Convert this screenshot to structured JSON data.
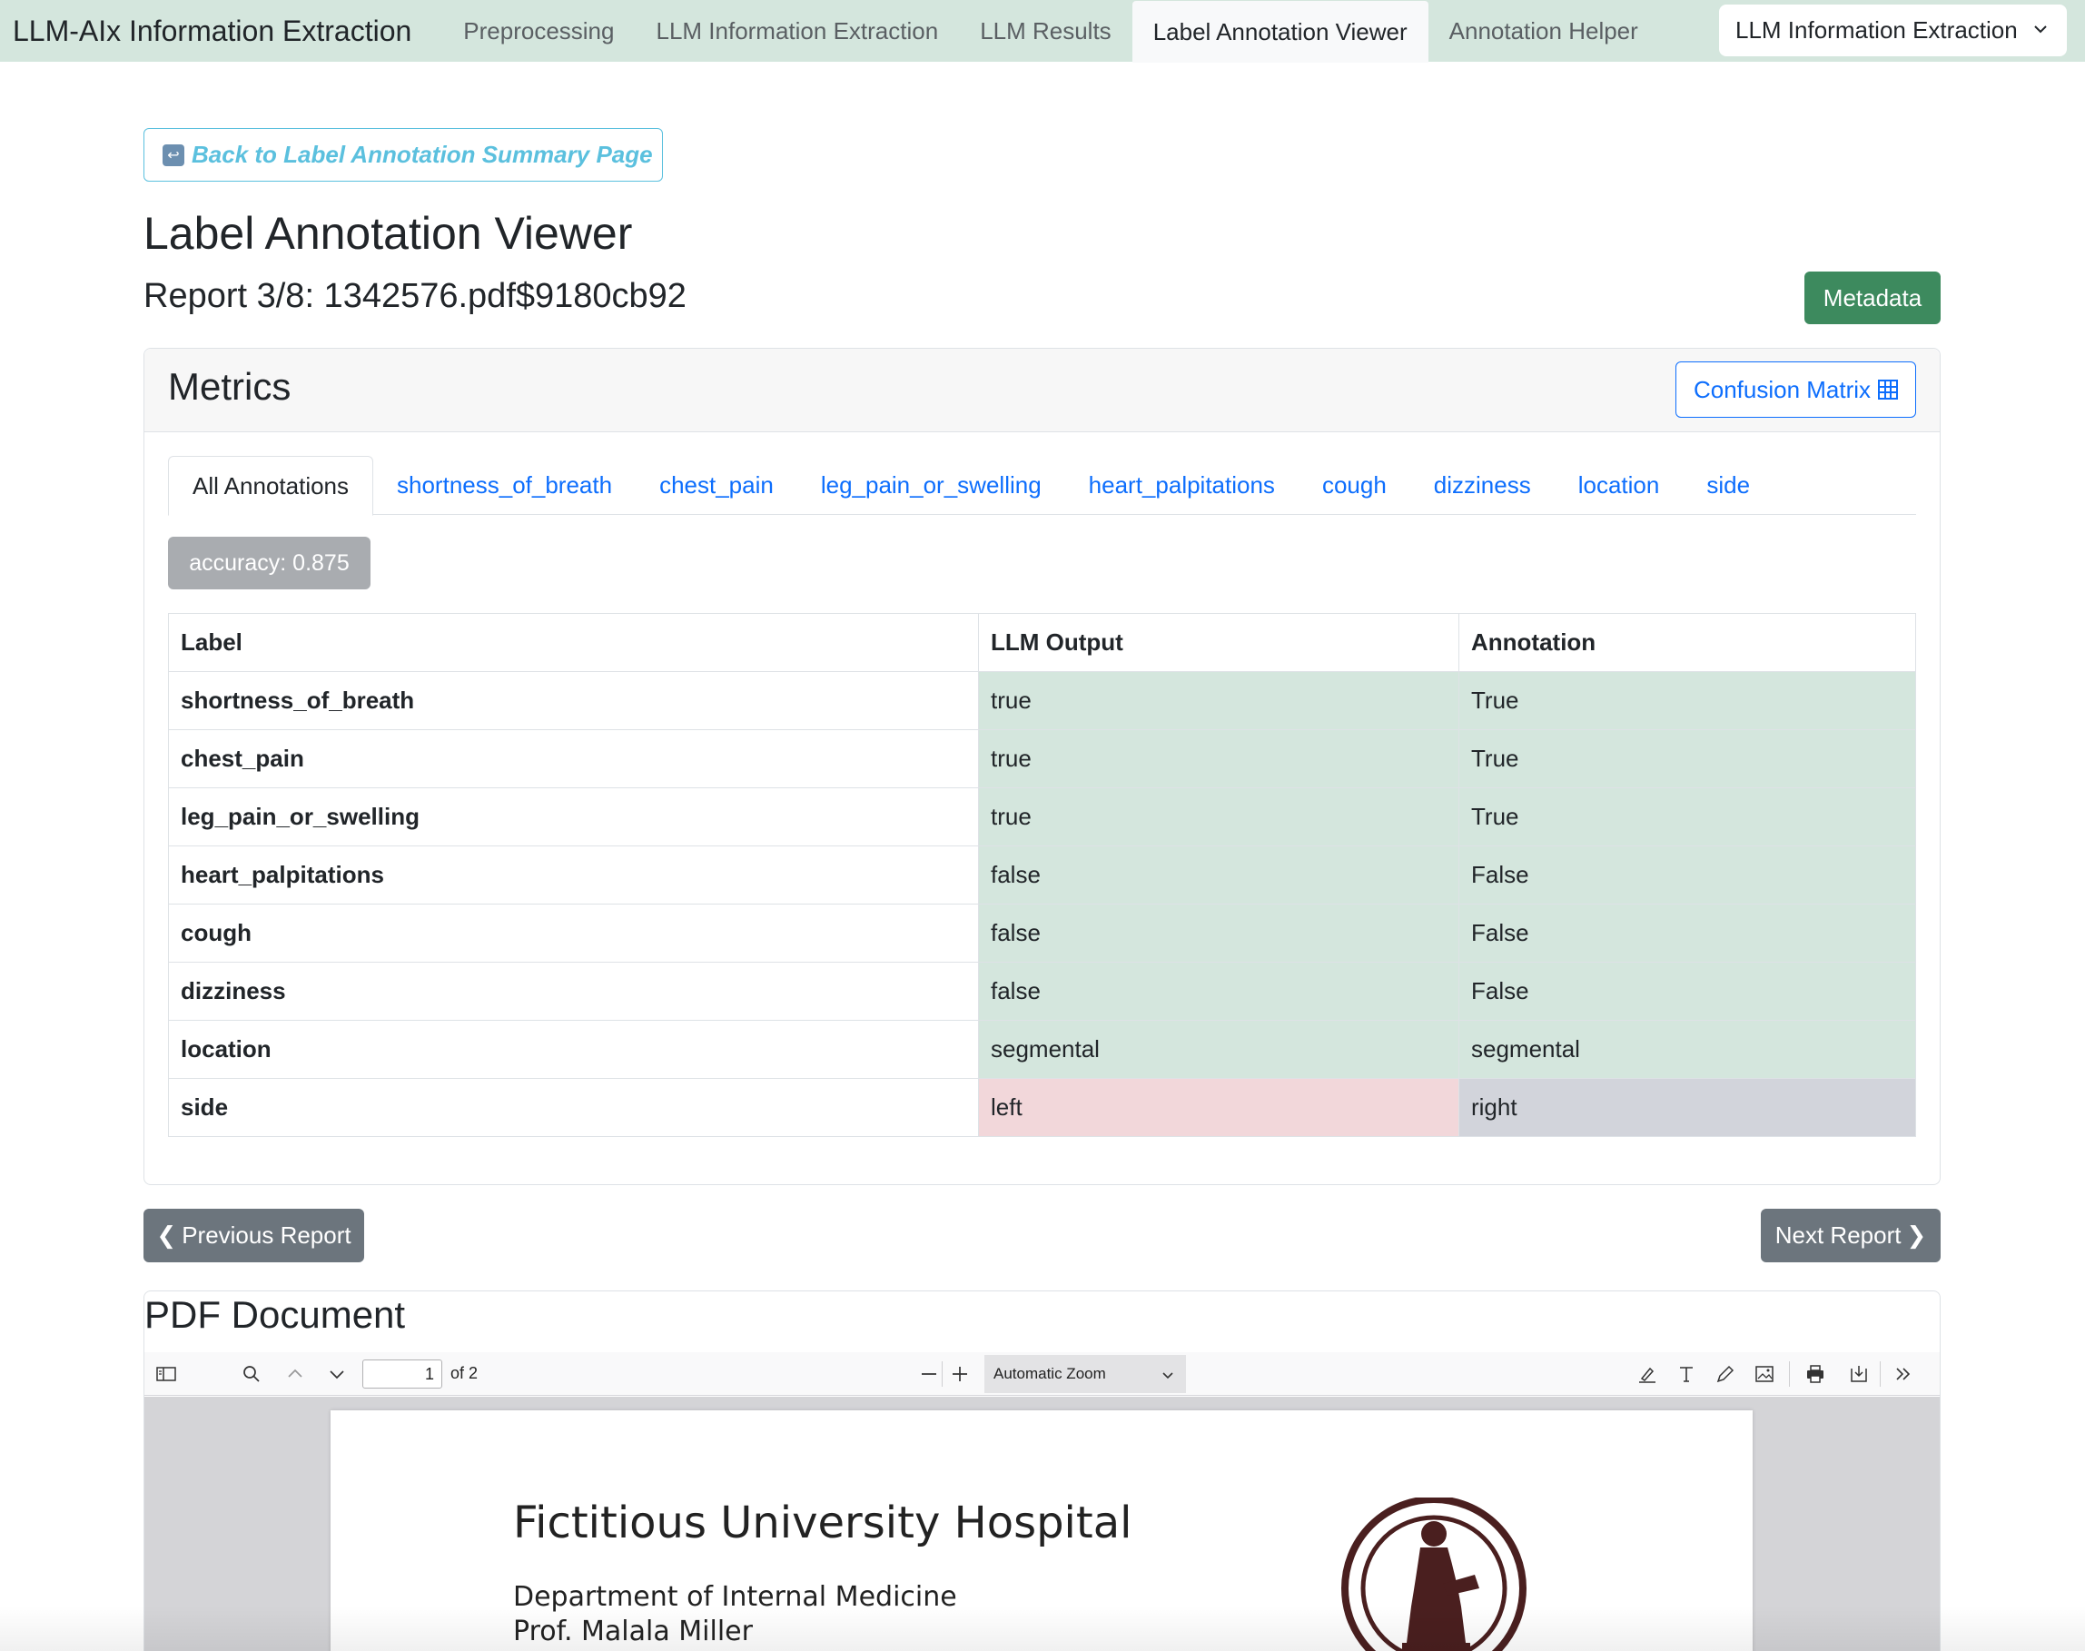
{
  "navbar": {
    "brand": "LLM-AIx Information Extraction",
    "links": [
      {
        "label": "Preprocessing",
        "active": false
      },
      {
        "label": "LLM Information Extraction",
        "active": false
      },
      {
        "label": "LLM Results",
        "active": false
      },
      {
        "label": "Label Annotation Viewer",
        "active": true
      },
      {
        "label": "Annotation Helper",
        "active": false
      }
    ],
    "mode_select": "LLM Information Extraction"
  },
  "back_button": "Back to Label Annotation Summary Page",
  "page_title": "Label Annotation Viewer",
  "report_title": "Report 3/8: 1342576.pdf$9180cb92",
  "metadata_button": "Metadata",
  "metrics": {
    "title": "Metrics",
    "confusion_matrix_button": "Confusion Matrix",
    "tabs": [
      {
        "label": "All Annotations",
        "active": true
      },
      {
        "label": "shortness_of_breath",
        "active": false
      },
      {
        "label": "chest_pain",
        "active": false
      },
      {
        "label": "leg_pain_or_swelling",
        "active": false
      },
      {
        "label": "heart_palpitations",
        "active": false
      },
      {
        "label": "cough",
        "active": false
      },
      {
        "label": "dizziness",
        "active": false
      },
      {
        "label": "location",
        "active": false
      },
      {
        "label": "side",
        "active": false
      }
    ],
    "accuracy_badge": "accuracy: 0.875",
    "table": {
      "headers": [
        "Label",
        "LLM Output",
        "Annotation"
      ],
      "rows": [
        {
          "label": "shortness_of_breath",
          "llm": "true",
          "annotation": "True",
          "match": true
        },
        {
          "label": "chest_pain",
          "llm": "true",
          "annotation": "True",
          "match": true
        },
        {
          "label": "leg_pain_or_swelling",
          "llm": "true",
          "annotation": "True",
          "match": true
        },
        {
          "label": "heart_palpitations",
          "llm": "false",
          "annotation": "False",
          "match": true
        },
        {
          "label": "cough",
          "llm": "false",
          "annotation": "False",
          "match": true
        },
        {
          "label": "dizziness",
          "llm": "false",
          "annotation": "False",
          "match": true
        },
        {
          "label": "location",
          "llm": "segmental",
          "annotation": "segmental",
          "match": true
        },
        {
          "label": "side",
          "llm": "left",
          "annotation": "right",
          "match": false
        }
      ]
    }
  },
  "prev_button": "Previous Report",
  "next_button": "Next Report",
  "pdf": {
    "title": "PDF Document",
    "page_number": "1",
    "page_of": "of 2",
    "zoom": "Automatic Zoom",
    "doc_title": "Fictitious University Hospital",
    "doc_dept": "Department of Internal Medicine",
    "doc_prof": "Prof. Malala Miller"
  },
  "colors": {
    "navbar_bg": "#d4e6dd",
    "match_cell": "#d4e6dd",
    "mismatch_llm_cell": "#f2d7da",
    "mismatch_annotation_cell": "#d2d4db",
    "metadata_button": "#3d8a5e",
    "link_blue": "#0d6efd",
    "back_button": "#5bc0de"
  }
}
